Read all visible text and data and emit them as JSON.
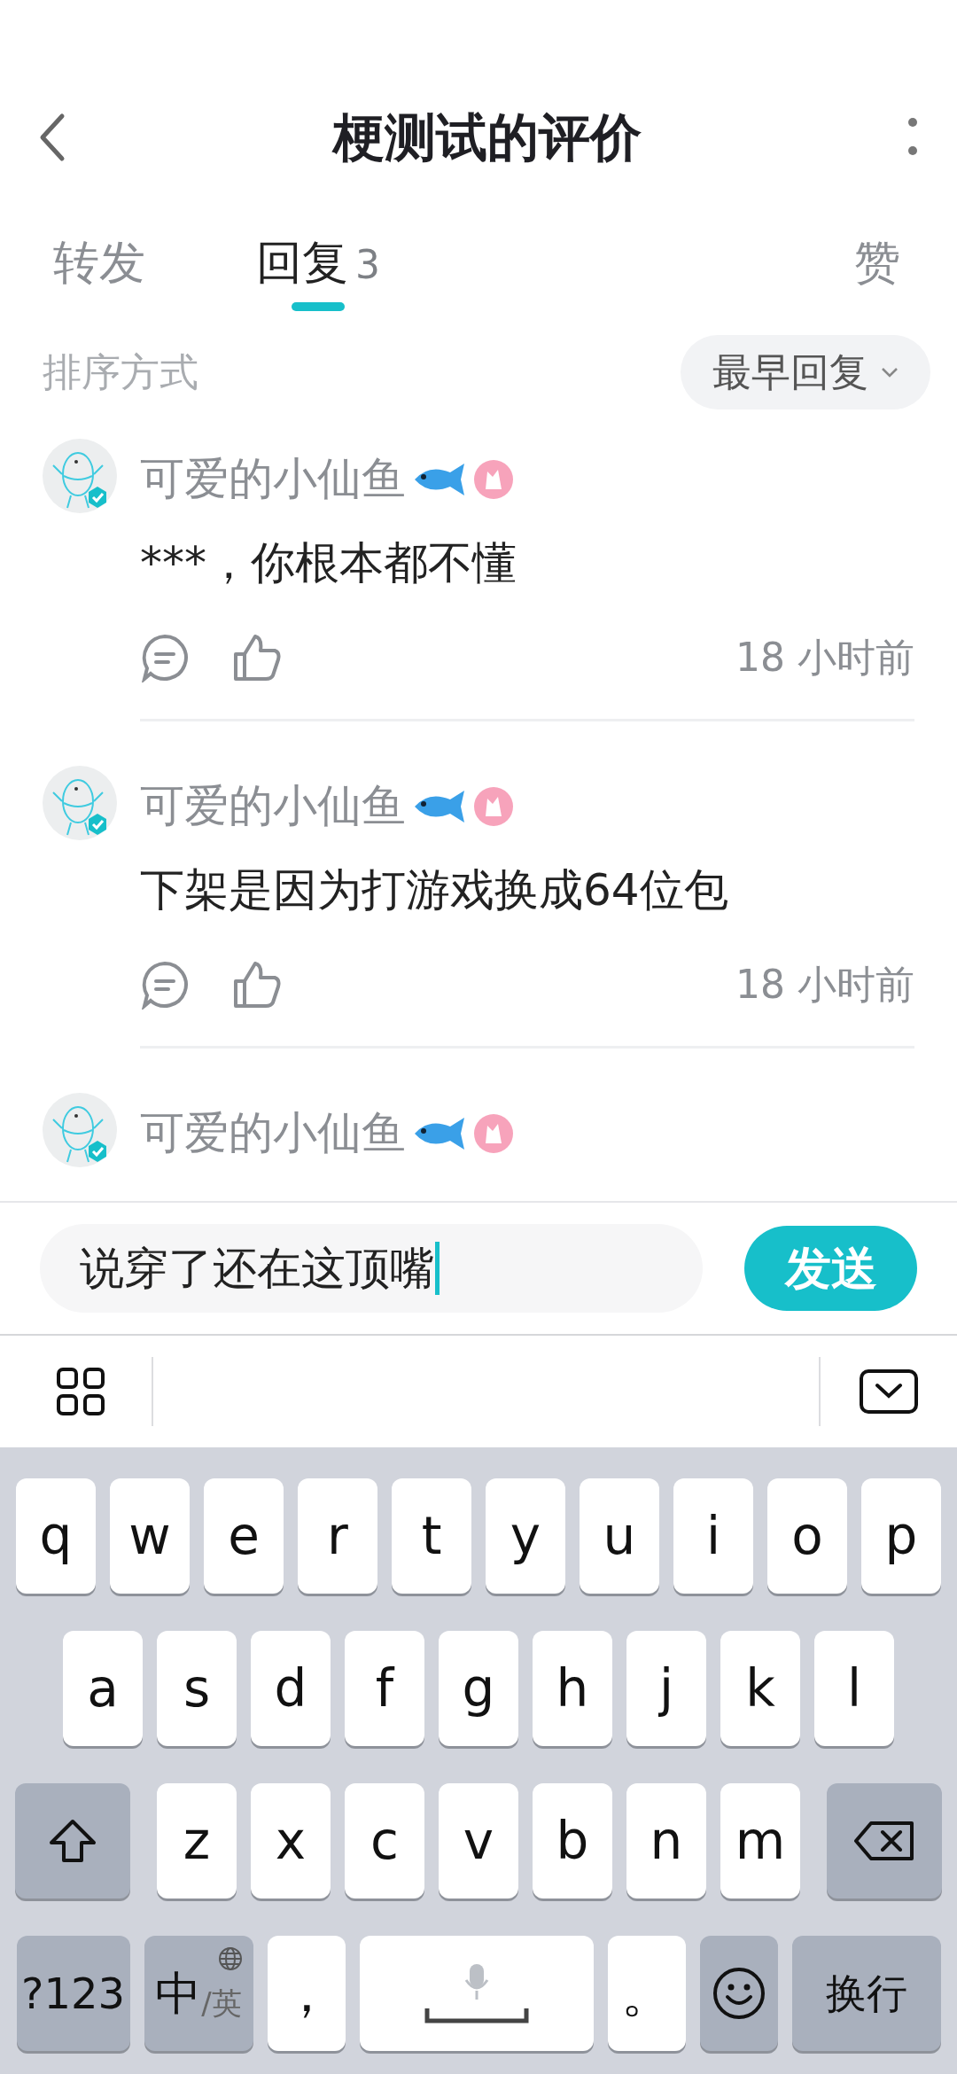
{
  "header": {
    "title": "梗测试的评价"
  },
  "tabs": [
    {
      "label": "转发",
      "selected": false
    },
    {
      "label": "回复",
      "count": "3",
      "selected": true
    },
    {
      "label": "赞",
      "selected": false
    }
  ],
  "sort": {
    "label": "排序方式",
    "value": "最早回复"
  },
  "comments": [
    {
      "user": "可爱的小仙鱼",
      "text": "***，你根本都不懂",
      "time": "18 小时前"
    },
    {
      "user": "可爱的小仙鱼",
      "text": "下架是因为打游戏换成64位包",
      "time": "18 小时前"
    },
    {
      "user": "可爱的小仙鱼"
    }
  ],
  "composer": {
    "value": "说穿了还在这顶嘴",
    "send": "发送"
  },
  "keyboard": {
    "rows": [
      {
        "keys": [
          {
            "kind": "letter",
            "label": "q"
          },
          {
            "kind": "letter",
            "label": "w"
          },
          {
            "kind": "letter",
            "label": "e"
          },
          {
            "kind": "letter",
            "label": "r"
          },
          {
            "kind": "letter",
            "label": "t"
          },
          {
            "kind": "letter",
            "label": "y"
          },
          {
            "kind": "letter",
            "label": "u"
          },
          {
            "kind": "letter",
            "label": "i"
          },
          {
            "kind": "letter",
            "label": "o"
          },
          {
            "kind": "letter",
            "label": "p"
          }
        ]
      },
      {
        "keys": [
          {
            "kind": "letter",
            "label": "a"
          },
          {
            "kind": "letter",
            "label": "s"
          },
          {
            "kind": "letter",
            "label": "d"
          },
          {
            "kind": "letter",
            "label": "f"
          },
          {
            "kind": "letter",
            "label": "g"
          },
          {
            "kind": "letter",
            "label": "h"
          },
          {
            "kind": "letter",
            "label": "j"
          },
          {
            "kind": "letter",
            "label": "k"
          },
          {
            "kind": "letter",
            "label": "l"
          }
        ]
      },
      {
        "keys": [
          {
            "kind": "shift"
          },
          {
            "kind": "letter",
            "label": "z"
          },
          {
            "kind": "letter",
            "label": "x"
          },
          {
            "kind": "letter",
            "label": "c"
          },
          {
            "kind": "letter",
            "label": "v"
          },
          {
            "kind": "letter",
            "label": "b"
          },
          {
            "kind": "letter",
            "label": "n"
          },
          {
            "kind": "letter",
            "label": "m"
          },
          {
            "kind": "backspace"
          }
        ]
      }
    ],
    "bottom_row": [
      {
        "kind": "symbols",
        "label": "?123"
      },
      {
        "kind": "lang",
        "label": "中",
        "sublabel": "/英"
      },
      {
        "kind": "punct",
        "label": "，"
      },
      {
        "kind": "space"
      },
      {
        "kind": "punct",
        "label": "。"
      },
      {
        "kind": "emoji"
      },
      {
        "kind": "enter",
        "label": "换行"
      }
    ]
  }
}
